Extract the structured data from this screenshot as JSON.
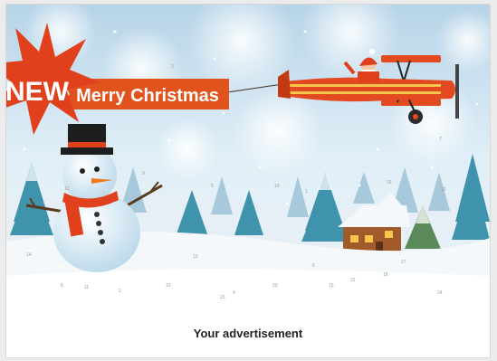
{
  "badge": {
    "label": "NEW"
  },
  "banner": {
    "text": "Merry Christmas"
  },
  "footer": {
    "caption": "Your advertisement"
  },
  "door_numbers": [
    "3",
    "7",
    "12",
    "5",
    "19",
    "22",
    "1",
    "16",
    "9",
    "14",
    "24",
    "10",
    "2",
    "18",
    "6",
    "21",
    "11",
    "4",
    "23",
    "15",
    "8",
    "20",
    "13",
    "17"
  ],
  "colors": {
    "sky": "#cfe3f0",
    "snow": "#f4f8fb",
    "banner": "#e2521d",
    "plane": "#e34a1f",
    "tree": "#3f93ad",
    "scarf": "#e0401c"
  }
}
